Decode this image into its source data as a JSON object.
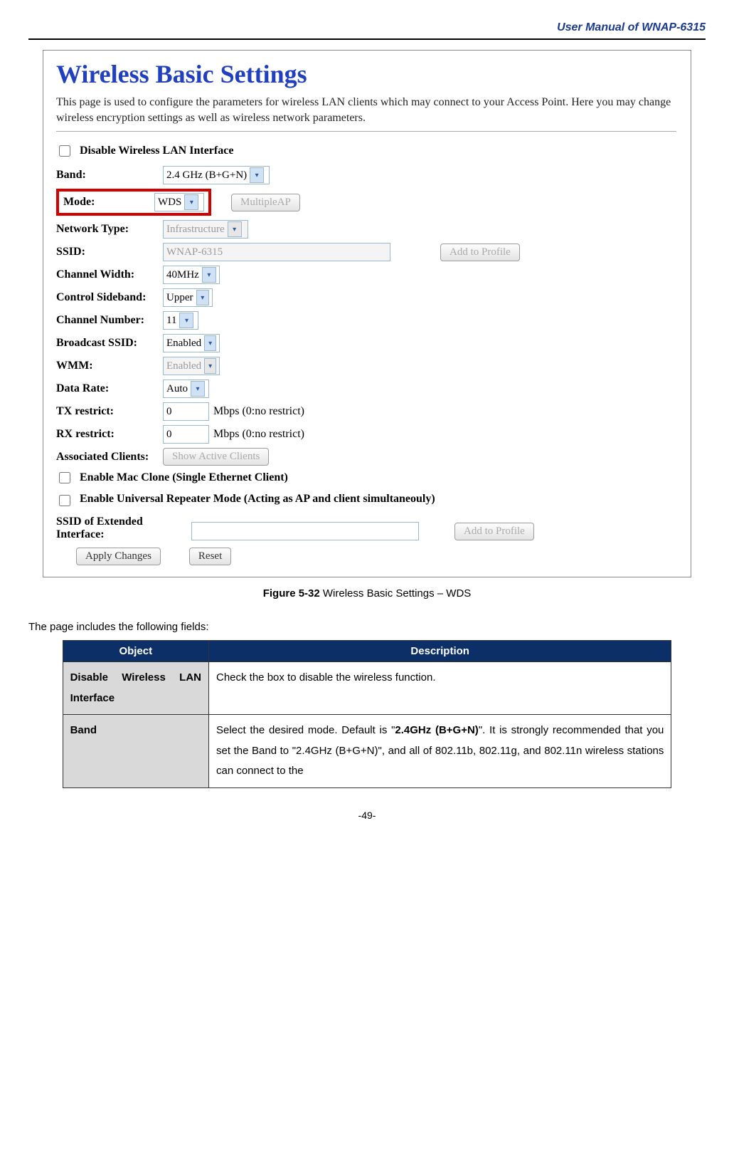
{
  "header": "User Manual of WNAP-6315",
  "panel": {
    "title": "Wireless Basic Settings",
    "description": "This page is used to configure the parameters for wireless LAN clients which may connect to your Access Point. Here you may change wireless encryption settings as well as wireless network parameters."
  },
  "form": {
    "disable_checkbox_label": "Disable Wireless LAN Interface",
    "band_label": "Band:",
    "band_value": "2.4 GHz (B+G+N)",
    "mode_label": "Mode:",
    "mode_value": "WDS",
    "multiple_ap_button": "MultipleAP",
    "network_type_label": "Network Type:",
    "network_type_value": "Infrastructure",
    "ssid_label": "SSID:",
    "ssid_value": "WNAP-6315",
    "add_to_profile_button": "Add to Profile",
    "channel_width_label": "Channel Width:",
    "channel_width_value": "40MHz",
    "control_sideband_label": "Control Sideband:",
    "control_sideband_value": "Upper",
    "channel_number_label": "Channel Number:",
    "channel_number_value": "11",
    "broadcast_ssid_label": "Broadcast SSID:",
    "broadcast_ssid_value": "Enabled",
    "wmm_label": "WMM:",
    "wmm_value": "Enabled",
    "data_rate_label": "Data Rate:",
    "data_rate_value": "Auto",
    "tx_restrict_label": "TX restrict:",
    "tx_restrict_value": "0",
    "tx_restrict_suffix": "Mbps (0:no restrict)",
    "rx_restrict_label": "RX restrict:",
    "rx_restrict_value": "0",
    "rx_restrict_suffix": "Mbps (0:no restrict)",
    "associated_clients_label": "Associated Clients:",
    "show_active_clients_button": "Show Active Clients",
    "enable_mac_clone_label": "Enable Mac Clone (Single Ethernet Client)",
    "enable_universal_repeater_label": "Enable Universal Repeater Mode (Acting as AP and client simultaneouly)",
    "ssid_ext_label": "SSID of Extended Interface:",
    "add_to_profile_button_2": "Add to Profile",
    "apply_changes_button": "Apply Changes",
    "reset_button": "Reset"
  },
  "figure_caption_bold": "Figure 5-32",
  "figure_caption_rest": " Wireless Basic Settings – WDS",
  "intro": "The page includes the following fields:",
  "table": {
    "head_object": "Object",
    "head_description": "Description",
    "rows": [
      {
        "object": "Disable Wireless LAN Interface",
        "description": "Check the box to disable the wireless function."
      },
      {
        "object": "Band",
        "desc_pre": "Select the desired mode. Default is \"",
        "desc_bold": "2.4GHz (B+G+N)",
        "desc_post": "\". It is strongly recommended that you set the Band to \"2.4GHz (B+G+N)\", and all of 802.11b, 802.11g, and 802.11n wireless stations can connect to the"
      }
    ]
  },
  "page_number": "-49-"
}
